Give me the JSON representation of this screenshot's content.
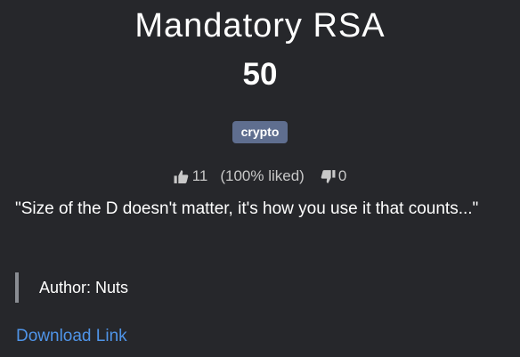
{
  "challenge": {
    "name": "Mandatory RSA",
    "value": "50",
    "tag": "crypto",
    "rating": {
      "likes": "11",
      "liked_pct": "(100% liked)",
      "dislikes": "0"
    },
    "description": "\"Size of the D doesn't matter, it's how you use it that counts...\"",
    "author": "Author: Nuts",
    "download_label": "Download Link"
  },
  "colors": {
    "background": "#26272b",
    "tag_bg": "#5f6e8f",
    "link": "#4f94e8",
    "quote_bar": "#8a8d93"
  },
  "icons": [
    "thumbs-up-icon",
    "thumbs-down-icon"
  ]
}
